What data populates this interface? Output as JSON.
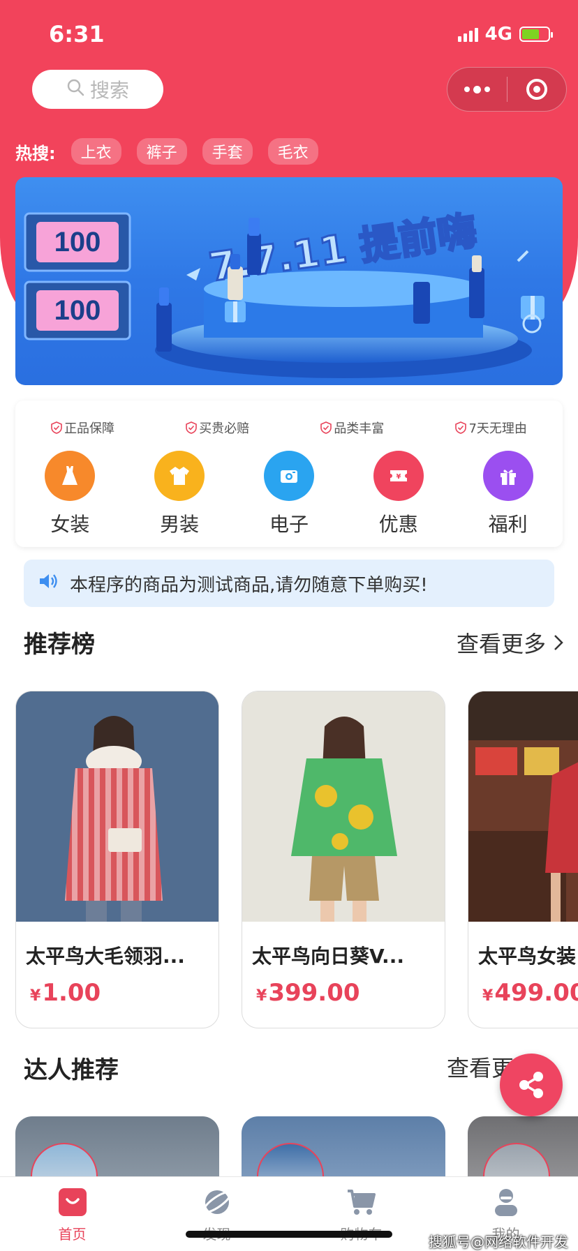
{
  "status_bar": {
    "time": "6:31",
    "network": "4G"
  },
  "search": {
    "placeholder": "搜索"
  },
  "hot_search": {
    "label": "热搜:",
    "tags": [
      "上衣",
      "裤子",
      "手套",
      "毛衣"
    ]
  },
  "banner": {
    "coupon_values": [
      "100",
      "100"
    ],
    "headline": "7.7.11 提前嗨"
  },
  "guarantees": [
    "正品保障",
    "买贵必赔",
    "品类丰富",
    "7天无理由"
  ],
  "categories": [
    {
      "label": "女装",
      "icon": "dress-icon",
      "color": "#f7892b"
    },
    {
      "label": "男装",
      "icon": "shirt-icon",
      "color": "#f9b21d"
    },
    {
      "label": "电子",
      "icon": "camera-icon",
      "color": "#2aa4f0"
    },
    {
      "label": "优惠",
      "icon": "ticket-icon",
      "color": "#f0445e"
    },
    {
      "label": "福利",
      "icon": "gift-icon",
      "color": "#9b4ff0"
    }
  ],
  "notice": {
    "text": "本程序的商品为测试商品,请勿随意下单购买!"
  },
  "recommend": {
    "title": "推荐榜",
    "more": "查看更多",
    "products": [
      {
        "name": "太平鸟大毛领羽...",
        "currency": "¥",
        "price": "1.00"
      },
      {
        "name": "太平鸟向日葵V...",
        "currency": "¥",
        "price": "399.00"
      },
      {
        "name": "太平鸟女装",
        "currency": "¥",
        "price": "499.00"
      }
    ]
  },
  "experts": {
    "title": "达人推荐",
    "more": "查看更多"
  },
  "tabbar": [
    {
      "label": "首页",
      "icon": "home-icon",
      "active": true
    },
    {
      "label": "发现",
      "icon": "planet-icon",
      "active": false
    },
    {
      "label": "购物车",
      "icon": "cart-icon",
      "active": false
    },
    {
      "label": "我的",
      "icon": "user-icon",
      "active": false
    }
  ],
  "watermark": "搜狐号@网络软件开发",
  "colors": {
    "brand": "#f2435b",
    "price": "#e8435a",
    "notice_bg": "#e4f0fd"
  }
}
